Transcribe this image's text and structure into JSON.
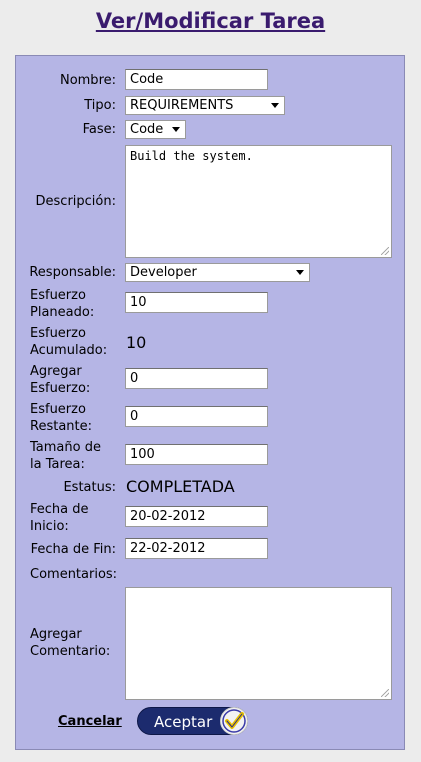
{
  "page": {
    "title": "Ver/Modificar Tarea"
  },
  "form": {
    "nombre": {
      "label": "Nombre:",
      "value": "Code"
    },
    "tipo": {
      "label": "Tipo:",
      "value": "REQUIREMENTS"
    },
    "fase": {
      "label": "Fase:",
      "value": "Code"
    },
    "descripcion": {
      "label": "Descripción:",
      "value": "Build the system."
    },
    "responsable": {
      "label": "Responsable:",
      "value": "Developer"
    },
    "esfuerzo_planeado": {
      "label_1": "Esfuerzo",
      "label_2": "Planeado:",
      "value": "10"
    },
    "esfuerzo_acumulado": {
      "label_1": "Esfuerzo",
      "label_2": "Acumulado:",
      "value": "10"
    },
    "agregar_esfuerzo": {
      "label_1": "Agregar",
      "label_2": "Esfuerzo:",
      "value": "0"
    },
    "esfuerzo_restante": {
      "label_1": "Esfuerzo",
      "label_2": "Restante:",
      "value": "0"
    },
    "tamano_tarea": {
      "label_1": "Tamaño de",
      "label_2": "la Tarea:",
      "value": "100"
    },
    "estatus": {
      "label": "Estatus:",
      "value": "COMPLETADA"
    },
    "fecha_inicio": {
      "label_1": "Fecha de",
      "label_2": "Inicio:",
      "value": "20-02-2012"
    },
    "fecha_fin": {
      "label": "Fecha de Fin:",
      "value": "22-02-2012"
    },
    "comentarios": {
      "label": "Comentarios:"
    },
    "agregar_comentario": {
      "label_1": "Agregar",
      "label_2": "Comentario:",
      "value": ""
    }
  },
  "actions": {
    "cancel_label": "Cancelar",
    "accept_label": "Aceptar"
  },
  "colors": {
    "panel_bg": "#b5b5e5",
    "title": "#3a1b6e",
    "button_bg": "#1c2b6e",
    "check": "#e8c200"
  }
}
